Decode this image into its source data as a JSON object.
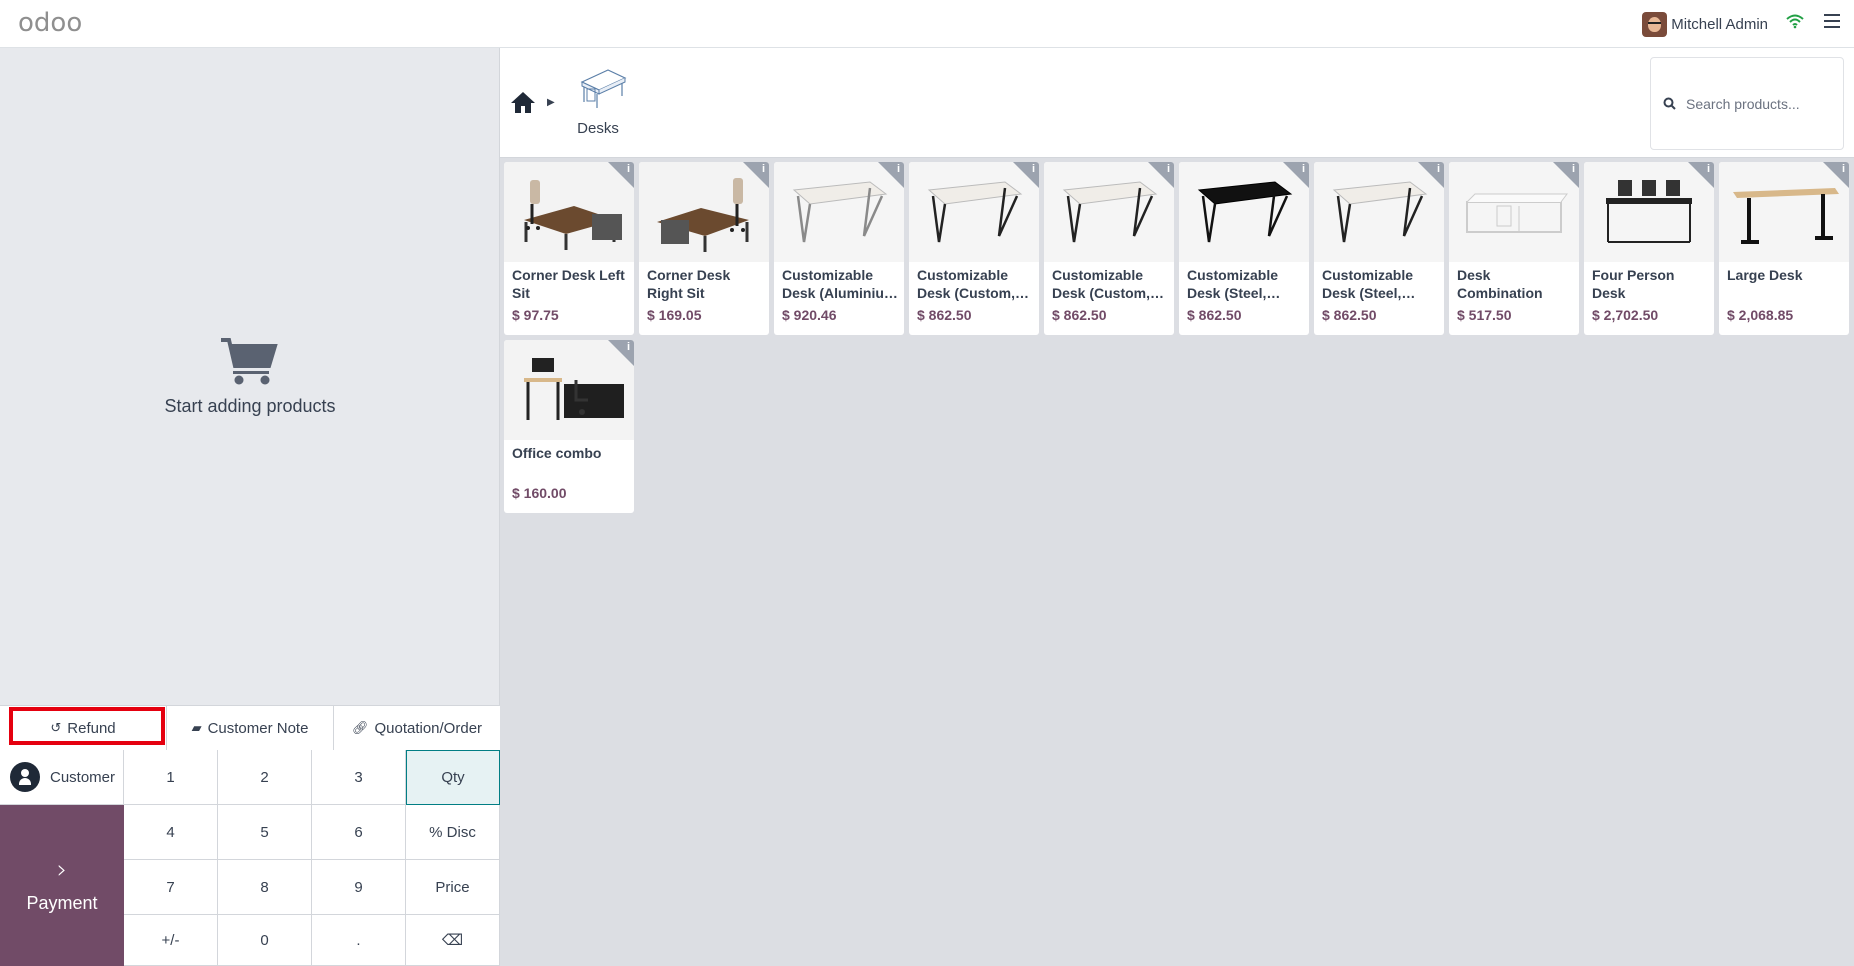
{
  "header": {
    "logo": "odoo",
    "user_name": "Mitchell Admin"
  },
  "order": {
    "empty_text": "Start adding products"
  },
  "controls": {
    "refund": "Refund",
    "customer_note": "Customer Note",
    "quotation": "Quotation/Order"
  },
  "pad": {
    "customer": "Customer",
    "payment": "Payment",
    "keys": [
      "1",
      "2",
      "3",
      "Qty",
      "4",
      "5",
      "6",
      "% Disc",
      "7",
      "8",
      "9",
      "Price",
      "+/-",
      "0",
      ".",
      "⌫"
    ]
  },
  "category": {
    "name": "Desks"
  },
  "search": {
    "placeholder": "Search products..."
  },
  "products": [
    {
      "name": "Corner Desk Left Sit",
      "price": "$ 97.75",
      "image": "corner-desk-left"
    },
    {
      "name": "Corner Desk Right Sit",
      "price": "$ 169.05",
      "image": "corner-desk-right"
    },
    {
      "name": "Customizable Desk (Aluminiu…",
      "price": "$ 920.46",
      "image": "desk-white-aluminium"
    },
    {
      "name": "Customizable Desk (Custom,…",
      "price": "$ 862.50",
      "image": "desk-white-black"
    },
    {
      "name": "Customizable Desk (Custom,…",
      "price": "$ 862.50",
      "image": "desk-white-black"
    },
    {
      "name": "Customizable Desk (Steel,…",
      "price": "$ 862.50",
      "image": "desk-black"
    },
    {
      "name": "Customizable Desk (Steel,…",
      "price": "$ 862.50",
      "image": "desk-white-black"
    },
    {
      "name": "Desk Combination",
      "price": "$ 517.50",
      "image": "desk-combination"
    },
    {
      "name": "Four Person Desk",
      "price": "$ 2,702.50",
      "image": "four-person-desk"
    },
    {
      "name": "Large Desk",
      "price": "$ 2,068.85",
      "image": "large-desk"
    },
    {
      "name": "Office combo",
      "price": "$ 160.00",
      "image": "office-combo"
    }
  ],
  "colors": {
    "brand": "#714B67",
    "highlight": "#e5000f",
    "active_key": "#017e84"
  }
}
